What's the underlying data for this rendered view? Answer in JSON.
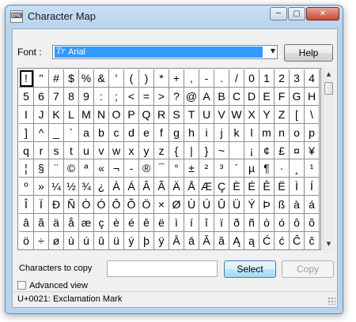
{
  "window": {
    "title": "Character Map",
    "controls": {
      "minimize": "─",
      "maximize": "▢",
      "close": "✕"
    }
  },
  "font": {
    "label": "Font :",
    "selected": "Arial",
    "type_badge": "Tr"
  },
  "buttons": {
    "help": "Help",
    "select": "Select",
    "copy": "Copy"
  },
  "characters": [
    "!",
    "\"",
    "#",
    "$",
    "%",
    "&",
    "'",
    "(",
    ")",
    "*",
    "+",
    ",",
    "-",
    ".",
    "/",
    "0",
    "1",
    "2",
    "3",
    "4",
    "5",
    "6",
    "7",
    "8",
    "9",
    ":",
    ";",
    "<",
    "=",
    ">",
    "?",
    "@",
    "A",
    "B",
    "C",
    "D",
    "E",
    "F",
    "G",
    "H",
    "I",
    "J",
    "K",
    "L",
    "M",
    "N",
    "O",
    "P",
    "Q",
    "R",
    "S",
    "T",
    "U",
    "V",
    "W",
    "X",
    "Y",
    "Z",
    "[",
    "\\",
    "]",
    "^",
    "_",
    "`",
    "a",
    "b",
    "c",
    "d",
    "e",
    "f",
    "g",
    "h",
    "i",
    "j",
    "k",
    "l",
    "m",
    "n",
    "o",
    "p",
    "q",
    "r",
    "s",
    "t",
    "u",
    "v",
    "w",
    "x",
    "y",
    "z",
    "{",
    "|",
    "}",
    "~",
    " ",
    "¡",
    "¢",
    "£",
    "¤",
    "¥",
    "¦",
    "§",
    "¨",
    "©",
    "ª",
    "«",
    "¬",
    "-",
    "®",
    "¯",
    "°",
    "±",
    "²",
    "³",
    "´",
    "µ",
    "¶",
    "·",
    "¸",
    "¹",
    "º",
    "»",
    "¼",
    "½",
    "¾",
    "¿",
    "À",
    "Á",
    "Â",
    "Ã",
    "Ä",
    "Å",
    "Æ",
    "Ç",
    "È",
    "É",
    "Ê",
    "Ë",
    "Ì",
    "Í",
    "Î",
    "Ï",
    "Ð",
    "Ñ",
    "Ò",
    "Ó",
    "Ô",
    "Õ",
    "Ö",
    "×",
    "Ø",
    "Ù",
    "Ú",
    "Û",
    "Ü",
    "Ý",
    "Þ",
    "ß",
    "à",
    "á",
    "â",
    "ã",
    "ä",
    "å",
    "æ",
    "ç",
    "è",
    "é",
    "ê",
    "ë",
    "ì",
    "í",
    "î",
    "ï",
    "ð",
    "ñ",
    "ò",
    "ó",
    "ô",
    "õ",
    "ö",
    "÷",
    "ø",
    "ù",
    "ú",
    "û",
    "ü",
    "ý",
    "þ",
    "ÿ",
    "Ā",
    "ā",
    "Ă",
    "ă",
    "Ą",
    "ą",
    "Ć",
    "ć",
    "Ĉ",
    "ĉ"
  ],
  "selected_index": 0,
  "copy": {
    "label": "Characters to copy",
    "value": ""
  },
  "advanced_view": {
    "label": "Advanced view",
    "checked": false
  },
  "status_text": "U+0021: Exclamation Mark",
  "scrollbar": {
    "up_icon": "▲",
    "down_icon": "▼"
  }
}
